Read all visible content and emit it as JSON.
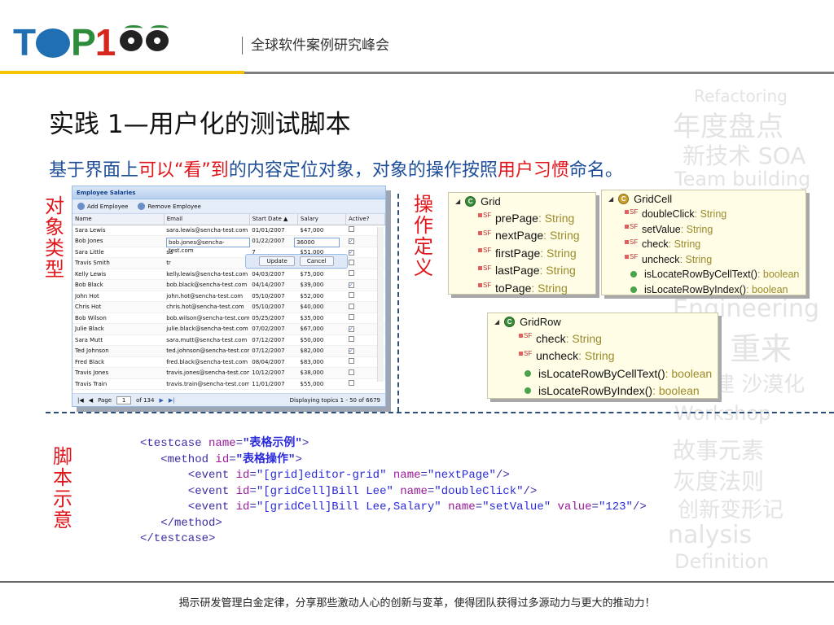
{
  "header": {
    "logo_text": "TOP1",
    "slogan": "全球软件案例研究峰会"
  },
  "watermark": [
    "Refactoring",
    "年度盘点",
    "新技术 SOA",
    "Team building",
    "Engineering",
    "重来",
    "建 沙漠化",
    "Workshop",
    "故事元素",
    "灰度法则",
    "创新变形记",
    "nalysis",
    "Definition"
  ],
  "title": "实践 1—用户化的测试脚本",
  "subtitle": {
    "p1": "基于界面上",
    "r1": "可以“看”到",
    "p2": "的内容定位对象，对象的操作按照",
    "r2": "用户习惯",
    "p3": "命名。"
  },
  "labels": {
    "object_type": [
      "对",
      "象",
      "类",
      "型"
    ],
    "operation_def": [
      "操",
      "作",
      "定",
      "义"
    ],
    "script_demo": [
      "脚",
      "本",
      "示",
      "意"
    ]
  },
  "grid": {
    "title": "Employee Salaries",
    "toolbar": [
      "Add Employee",
      "Remove Employee"
    ],
    "columns": [
      "Name",
      "Email",
      "Start Date ▲",
      "Salary",
      "Active?"
    ],
    "rows": [
      [
        "Sara Lewis",
        "sara.lewis@sencha-test.com",
        "01/01/2007",
        "$47,000",
        false
      ],
      [
        "Bob Jones",
        "bob.jones@sencha-test.com",
        "01/22/2007",
        "36000",
        true
      ],
      [
        "Sara Little",
        "sa",
        "7",
        "$51,000",
        true
      ],
      [
        "Travis Smith",
        "tr",
        "7",
        "$39,000",
        false
      ],
      [
        "Kelly Lewis",
        "kelly.lewis@sencha-test.com",
        "04/03/2007",
        "$75,000",
        false
      ],
      [
        "Bob Black",
        "bob.black@sencha-test.com",
        "04/14/2007",
        "$39,000",
        true
      ],
      [
        "John Hot",
        "john.hot@sencha-test.com",
        "05/10/2007",
        "$52,000",
        false
      ],
      [
        "Chris Hot",
        "chris.hot@sencha-test.com",
        "05/10/2007",
        "$40,000",
        false
      ],
      [
        "Bob Wilson",
        "bob.wilson@sencha-test.com",
        "05/25/2007",
        "$35,000",
        false
      ],
      [
        "Julie Black",
        "julie.black@sencha-test.com",
        "07/02/2007",
        "$67,000",
        true
      ],
      [
        "Sara Mutt",
        "sara.mutt@sencha-test.com",
        "07/12/2007",
        "$50,000",
        false
      ],
      [
        "Ted Johnson",
        "ted.johnson@sencha-test.com",
        "07/12/2007",
        "$82,000",
        true
      ],
      [
        "Fred Black",
        "fred.black@sencha-test.com",
        "08/04/2007",
        "$83,000",
        false
      ],
      [
        "Travis Jones",
        "travis.jones@sencha-test.com",
        "10/12/2007",
        "$38,000",
        false
      ],
      [
        "Travis Train",
        "travis.train@sencha-test.com",
        "11/01/2007",
        "$55,000",
        false
      ]
    ],
    "editor": {
      "update": "Update",
      "cancel": "Cancel"
    },
    "paging": {
      "page_label": "Page",
      "page_value": "1",
      "of": "of 134",
      "display": "Displaying topics 1 - 50 of 6679"
    }
  },
  "classes": {
    "grid": {
      "name": "Grid",
      "members": [
        {
          "name": "prePage",
          "type": " : String"
        },
        {
          "name": "nextPage",
          "type": " : String"
        },
        {
          "name": "firstPage",
          "type": " : String"
        },
        {
          "name": "lastPage",
          "type": " : String"
        },
        {
          "name": "toPage",
          "type": " : String"
        }
      ]
    },
    "gridcell": {
      "name": "GridCell",
      "members": [
        {
          "name": "doubleClick",
          "type": " : String"
        },
        {
          "name": "setValue",
          "type": " : String"
        },
        {
          "name": "check",
          "type": " : String"
        },
        {
          "name": "uncheck",
          "type": " : String"
        }
      ],
      "methods": [
        {
          "name": "isLocateRowByCellText()",
          "type": " : boolean"
        },
        {
          "name": "isLocateRowByIndex()",
          "type": " : boolean"
        }
      ]
    },
    "gridrow": {
      "name": "GridRow",
      "members": [
        {
          "name": "check",
          "type": " : String"
        },
        {
          "name": "uncheck",
          "type": " : String"
        }
      ],
      "methods": [
        {
          "name": "isLocateRowByCellText()",
          "type": " : boolean"
        },
        {
          "name": "isLocateRowByIndex()",
          "type": " : boolean"
        }
      ]
    }
  },
  "code": {
    "testcase_name": "\"表格示例\"",
    "method_id": "\"表格操作\"",
    "events": [
      {
        "id": "\"[grid]editor-grid\"",
        "name": "\"nextPage\""
      },
      {
        "id": "\"[gridCell]Bill Lee\"",
        "name": "\"doubleClick\""
      },
      {
        "id": "\"[gridCell]Bill Lee,Salary\"",
        "name": "\"setValue\"",
        "value": "\"123\""
      }
    ]
  },
  "footer": "揭示研发管理白金定律，分享那些激动人心的创新与变革，使得团队获得过多源动力与更大的推动力！"
}
